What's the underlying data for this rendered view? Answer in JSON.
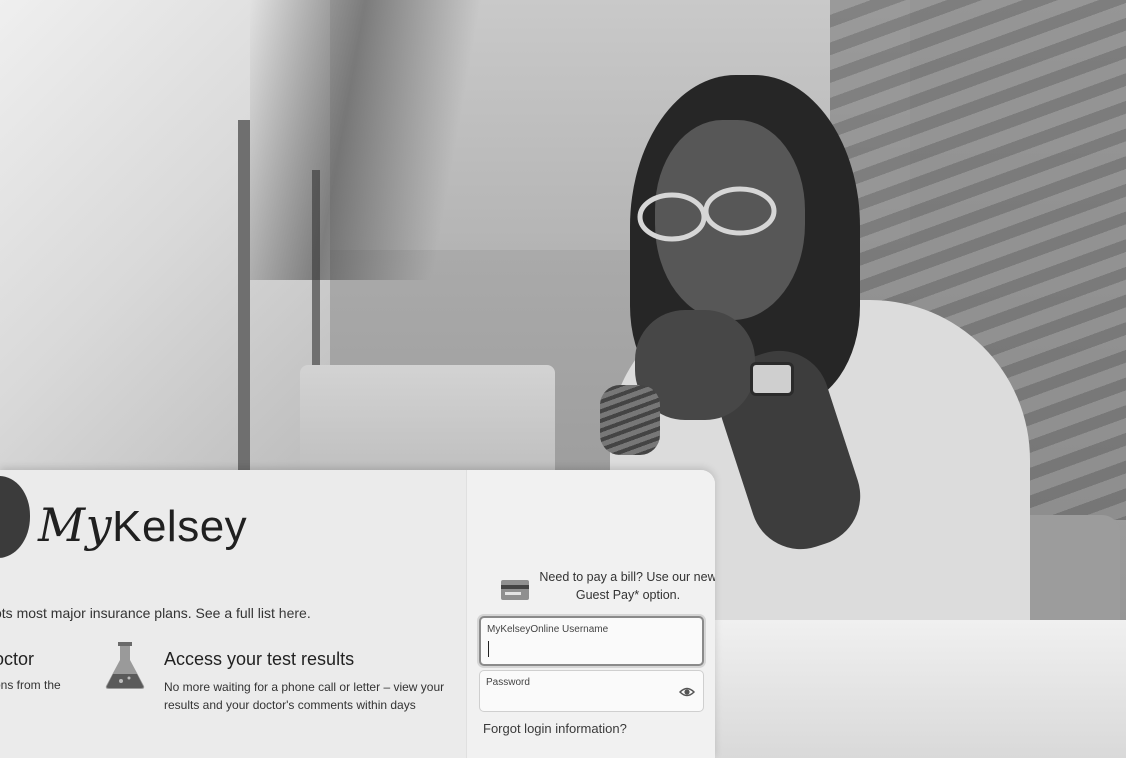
{
  "brand": {
    "logo_script": "My",
    "logo_plain": "Kelsey"
  },
  "insurance": {
    "text": "ots most major insurance plans. See a full list ",
    "link": "here",
    "tail": "."
  },
  "features": [
    {
      "title": "octor",
      "desc": "ons from the"
    },
    {
      "title": "Access your test results",
      "desc": "No more waiting for a phone call or letter – view your results and your doctor's comments within days",
      "icon": "flask-icon"
    }
  ],
  "login": {
    "guest_pay": "Need to pay a bill? Use our new Guest Pay* option.",
    "username_label": "MyKelseyOnline Username",
    "password_label": "Password",
    "forgot": "Forgot login information?"
  },
  "icons": {
    "credit_card": "credit-card-icon",
    "eye": "eye-icon",
    "logo": "apple-logo-icon"
  }
}
